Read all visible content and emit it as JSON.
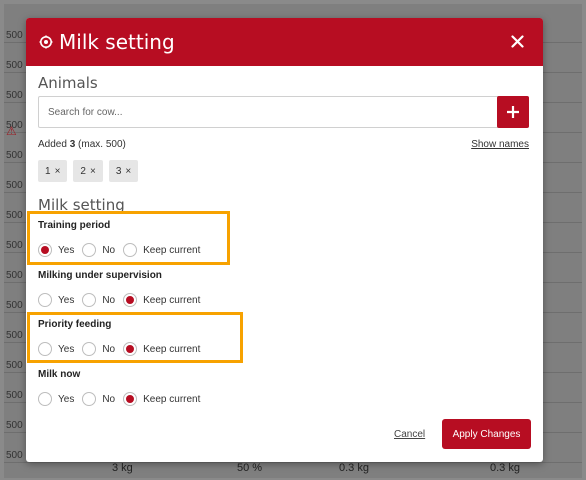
{
  "background": {
    "left_labels": [
      "500",
      "500",
      "500",
      "500",
      "500",
      "500",
      "500",
      "500",
      "500",
      "500",
      "500",
      "500",
      "500",
      "500",
      "500",
      "500"
    ],
    "bottom_values": [
      "3 kg",
      "50 %",
      "0.3 kg",
      "0.3 kg"
    ]
  },
  "dialog": {
    "title": "Milk setting",
    "icon": "gear-icon",
    "close_icon": "close-icon",
    "accent_color": "#b70d22",
    "highlight_color": "#f7a200"
  },
  "animals": {
    "section_title": "Animals",
    "search_placeholder": "Search for cow...",
    "add_icon": "plus-icon",
    "added_prefix": "Added",
    "added_count": "3",
    "added_suffix": "(max. 500)",
    "show_names": "Show names",
    "chips": [
      {
        "label": "1",
        "remove": "×"
      },
      {
        "label": "2",
        "remove": "×"
      },
      {
        "label": "3",
        "remove": "×"
      }
    ]
  },
  "milk_setting": {
    "section_title": "Milk setting",
    "groups": [
      {
        "label": "Training period",
        "options": [
          "Yes",
          "No",
          "Keep current"
        ],
        "selected": 0,
        "highlighted": true
      },
      {
        "label": "Milking under supervision",
        "options": [
          "Yes",
          "No",
          "Keep current"
        ],
        "selected": 2,
        "highlighted": false
      },
      {
        "label": "Priority feeding",
        "options": [
          "Yes",
          "No",
          "Keep current"
        ],
        "selected": 2,
        "highlighted": true
      },
      {
        "label": "Milk now",
        "options": [
          "Yes",
          "No",
          "Keep current"
        ],
        "selected": 2,
        "highlighted": false
      }
    ]
  },
  "footer": {
    "cancel_label": "Cancel",
    "apply_label": "Apply Changes"
  }
}
